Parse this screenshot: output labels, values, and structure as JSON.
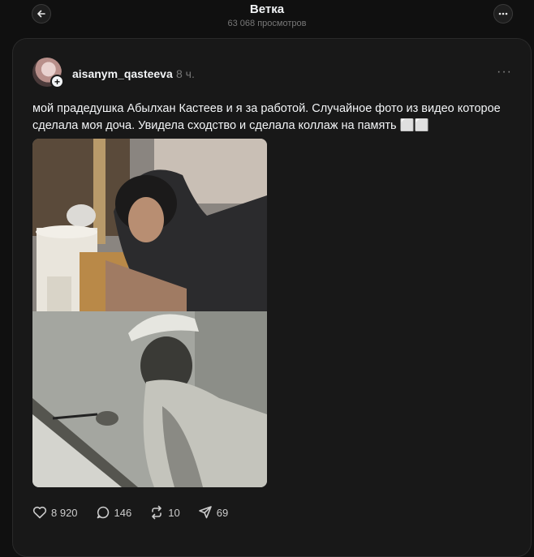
{
  "header": {
    "title": "Ветка",
    "views": "63 068 просмотров",
    "back_icon": "arrow-left-icon",
    "more_icon": "more-horizontal-icon"
  },
  "post": {
    "username": "aisanym_qasteeva",
    "time": "8 ч.",
    "text": "мой прадедушка Абылхан Кастеев и я за работой. Случайное фото из видео которое сделала моя доча. Увидела сходство и сделала коллаж на память ⬜⬜",
    "image_description_icons": [
      "photo-collage-image"
    ]
  },
  "actions": {
    "likes": "8 920",
    "replies": "146",
    "reposts": "10",
    "shares": "69"
  }
}
